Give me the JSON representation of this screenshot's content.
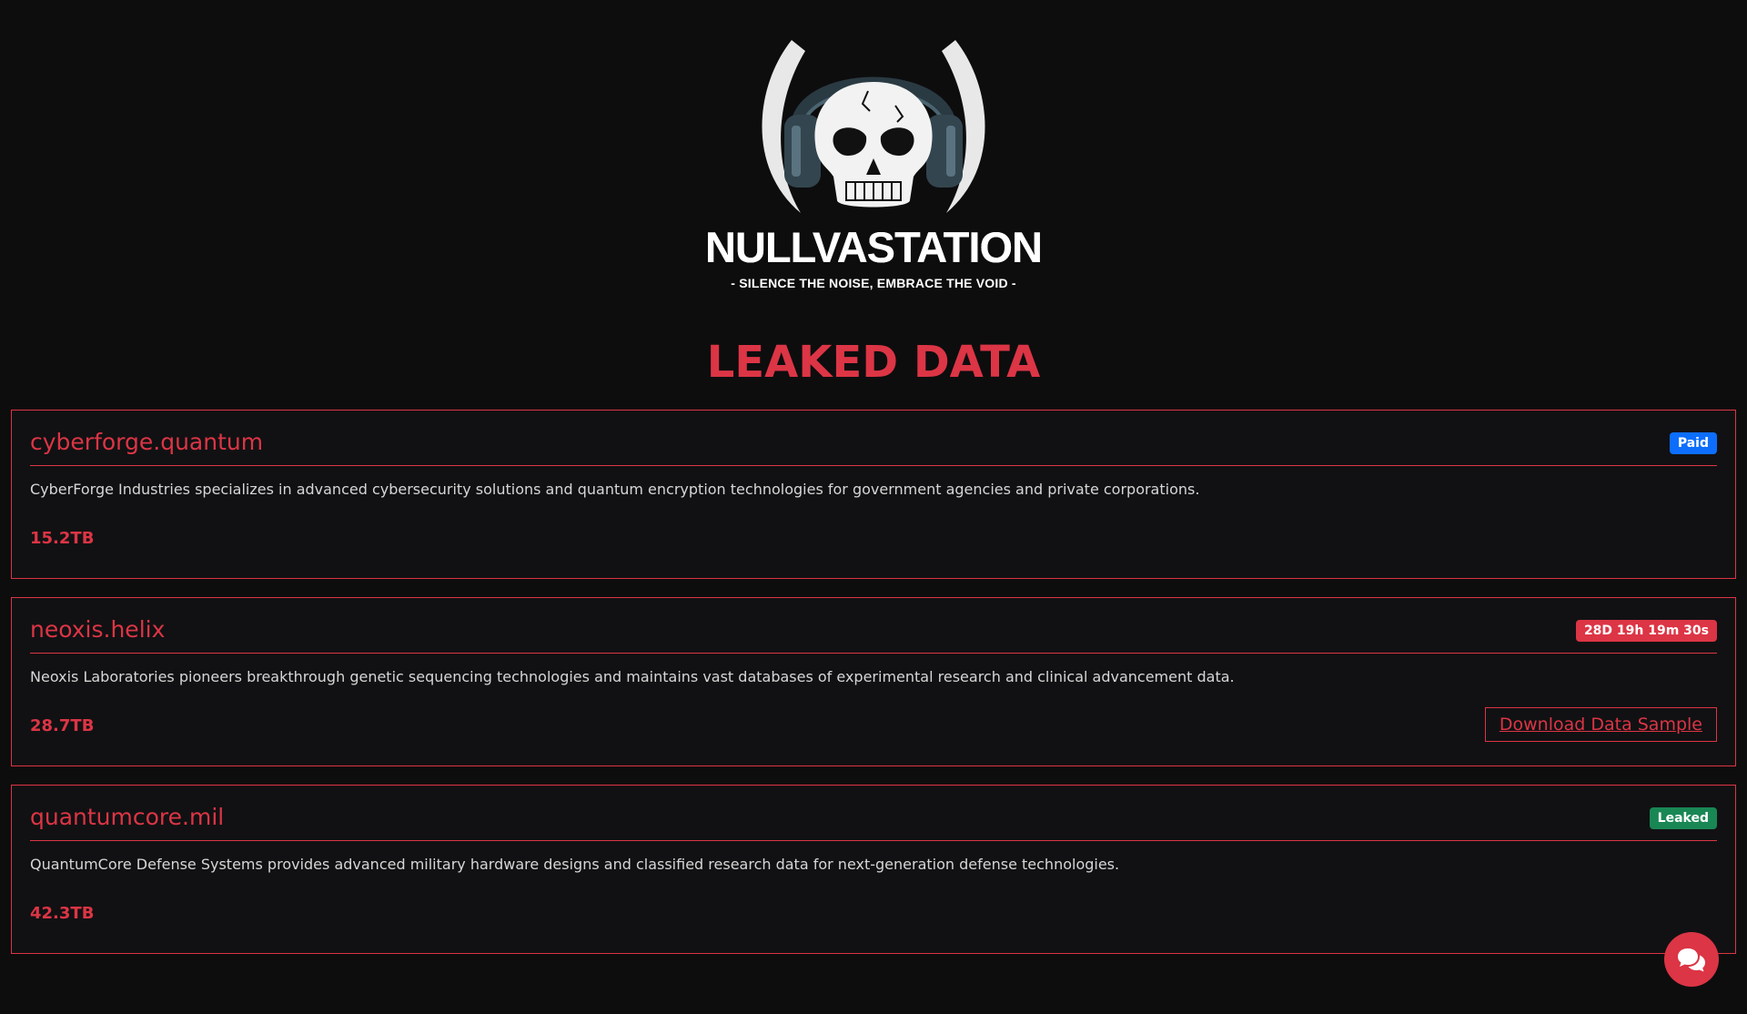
{
  "brand": {
    "name": "NULLVASTATION",
    "tagline": "- SILENCE THE NOISE, EMBRACE THE VOID -",
    "logo_icon": "skull-with-headphones-icon"
  },
  "page": {
    "title": "LEAKED DATA"
  },
  "colors": {
    "background": "#0d0d0e",
    "card_background": "#111113",
    "accent": "#dc3545",
    "badge_paid": "#0d6efd",
    "badge_leaked": "#198754",
    "text": "#d6d6d6"
  },
  "leaks": [
    {
      "domain": "cyberforge.quantum",
      "status": "Paid",
      "description": "CyberForge Industries specializes in advanced cybersecurity solutions and quantum encryption technologies for government agencies and private corporations.",
      "size": "15.2TB"
    },
    {
      "domain": "neoxis.helix",
      "status": "28D 19h 19m 30s",
      "description": "Neoxis Laboratories pioneers breakthrough genetic sequencing technologies and maintains vast databases of experimental research and clinical advancement data.",
      "size": "28.7TB",
      "download_label": "Download Data Sample"
    },
    {
      "domain": "quantumcore.mil",
      "status": "Leaked",
      "description": "QuantumCore Defense Systems provides advanced military hardware designs and classified research data for next-generation defense technologies.",
      "size": "42.3TB"
    }
  ],
  "chat": {
    "icon": "chat-bubbles-icon"
  }
}
